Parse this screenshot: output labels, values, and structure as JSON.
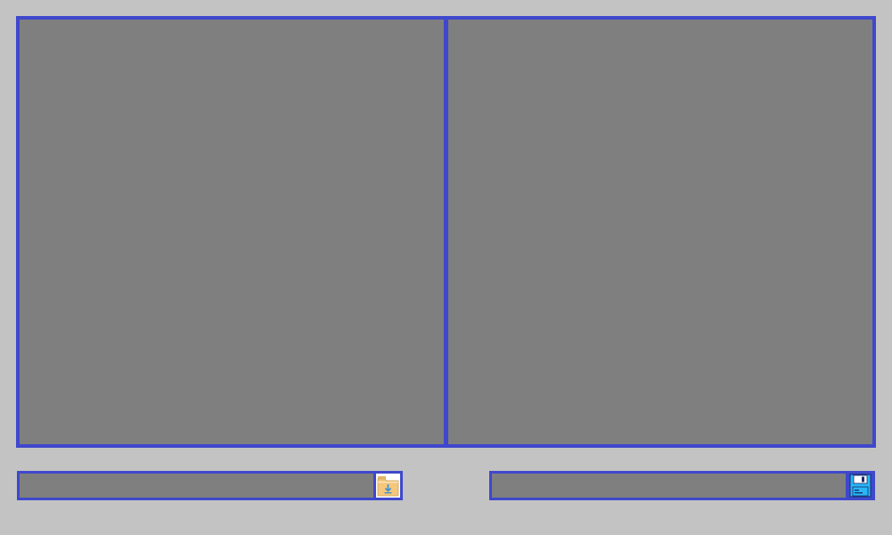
{
  "colors": {
    "background": "#c3c3c3",
    "pane_fill": "#7f7f7f",
    "accent_border": "#3f48cc",
    "folder_fill": "#f5c77a",
    "floppy_fill": "#29b6f6"
  },
  "left_pane": {
    "content": ""
  },
  "right_pane": {
    "content": ""
  },
  "open_field": {
    "value": "",
    "placeholder": "",
    "button_icon": "folder-download-icon"
  },
  "save_field": {
    "value": "",
    "placeholder": "",
    "button_icon": "floppy-disk-save-icon"
  }
}
